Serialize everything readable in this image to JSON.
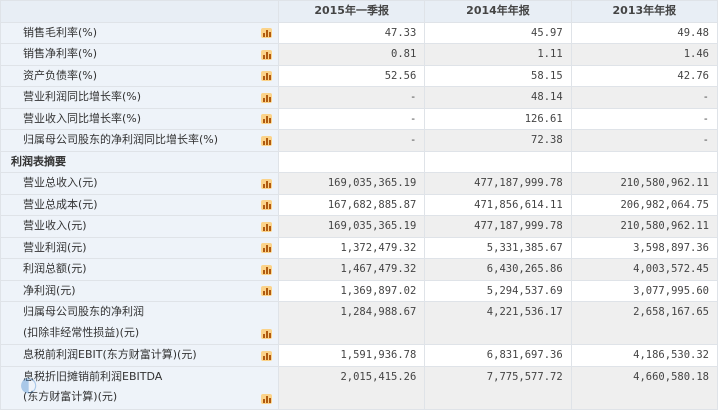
{
  "columns": [
    "2015年一季报",
    "2014年年报",
    "2013年年报"
  ],
  "rows": [
    {
      "label": "销售毛利率(%)",
      "values": [
        "47.33",
        "45.97",
        "49.48"
      ]
    },
    {
      "label": "销售净利率(%)",
      "values": [
        "0.81",
        "1.11",
        "1.46"
      ]
    },
    {
      "label": "资产负债率(%)",
      "values": [
        "52.56",
        "58.15",
        "42.76"
      ]
    },
    {
      "label": "营业利润同比增长率(%)",
      "values": [
        "-",
        "48.14",
        "-"
      ]
    },
    {
      "label": "营业收入同比增长率(%)",
      "values": [
        "-",
        "126.61",
        "-"
      ]
    },
    {
      "label": "归属母公司股东的净利润同比增长率(%)",
      "values": [
        "-",
        "72.38",
        "-"
      ]
    },
    {
      "section": "利润表摘要"
    },
    {
      "label": "营业总收入(元)",
      "values": [
        "169,035,365.19",
        "477,187,999.78",
        "210,580,962.11"
      ]
    },
    {
      "label": "营业总成本(元)",
      "values": [
        "167,682,885.87",
        "471,856,614.11",
        "206,982,064.75"
      ]
    },
    {
      "label": "营业收入(元)",
      "values": [
        "169,035,365.19",
        "477,187,999.78",
        "210,580,962.11"
      ]
    },
    {
      "label": "营业利润(元)",
      "values": [
        "1,372,479.32",
        "5,331,385.67",
        "3,598,897.36"
      ]
    },
    {
      "label": "利润总额(元)",
      "values": [
        "1,467,479.32",
        "6,430,265.86",
        "4,003,572.45"
      ]
    },
    {
      "label": "净利润(元)",
      "values": [
        "1,369,897.02",
        "5,294,537.69",
        "3,077,995.60"
      ]
    },
    {
      "label": "归属母公司股东的净利润",
      "label2": "(扣除非经常性损益)(元)",
      "values": [
        "1,284,988.67",
        "4,221,536.17",
        "2,658,167.65"
      ]
    },
    {
      "label": "息税前利润EBIT(东方财富计算)(元)",
      "values": [
        "1,591,936.78",
        "6,831,697.36",
        "4,186,530.32"
      ]
    },
    {
      "label": "息税折旧摊销前利润EBITDA",
      "label2": "(东方财富计算)(元)",
      "values": [
        "2,015,415.26",
        "7,775,577.72",
        "4,660,580.18"
      ]
    }
  ],
  "icons": {
    "chart": "bar-chart-icon"
  }
}
